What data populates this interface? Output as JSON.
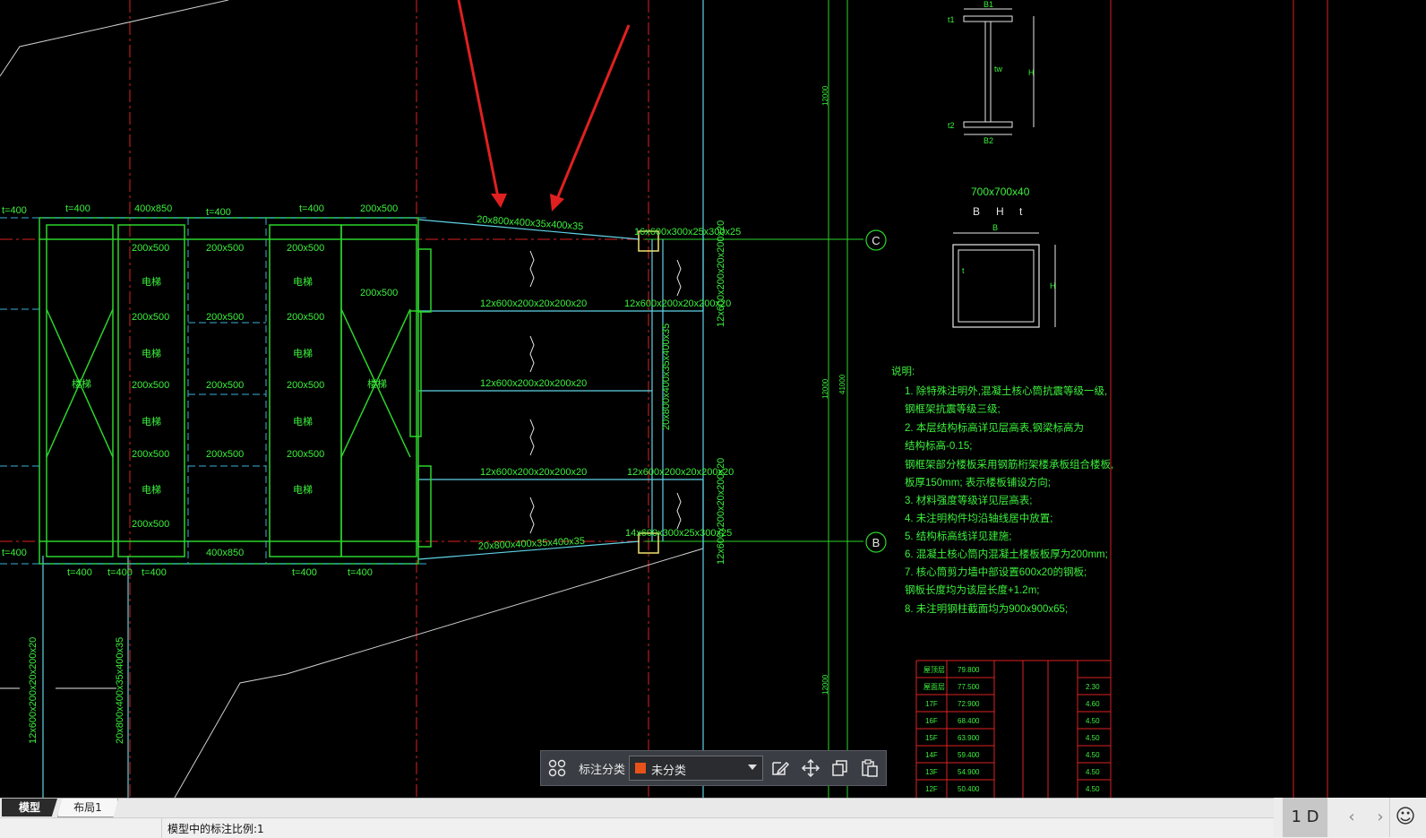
{
  "drawing": {
    "axis_labels": {
      "c": "C",
      "b": "B"
    },
    "dimensions": [
      "t=400",
      "t=400",
      "400x850",
      "t=400",
      "t=400",
      "200x500",
      "200x500",
      "200x500",
      "200x500",
      "200x500",
      "200x500",
      "200x500",
      "200x500",
      "200x500",
      "200x500",
      "200x500",
      "200x500",
      "200x500",
      "200x500",
      "200x500",
      "400x850",
      "t=400",
      "t=400",
      "t=400",
      "t=400",
      "t=400",
      "t=400"
    ],
    "beams": {
      "top_slanted": "20x800x400x35x400x35",
      "bottom_slanted": "20x800x400x35x400x35",
      "beam_1": "12x600x200x20x200x20",
      "beam_2": "12x600x200x20x200x20",
      "beam_3": "12x600x200x20x200x20",
      "beam_right_1": "12x600x200x20x200x20",
      "beam_right_2": "12x600x200x20x200x20",
      "col_top": "16x600x300x25x300x25",
      "col_bottom": "14x600x300x25x300x25",
      "vertical_1": "20x800x400x35x400x35",
      "vertical_2": "12x600x200x20x200x20",
      "vertical_3": "12x600x200x20x200x20",
      "vertical_left_1": "12x600x200x20x200x20",
      "vertical_left_2": "20x800x400x35x400x35"
    },
    "elevator_labels": [
      "电梯",
      "电梯",
      "电梯",
      "电梯",
      "电梯",
      "电梯",
      "电梯",
      "电梯"
    ],
    "stair_labels": [
      "楼梯",
      "楼梯"
    ],
    "section_i": {
      "b1": "B1",
      "b2": "B2",
      "h": "H",
      "tw": "tw",
      "t1": "t1",
      "t2": "t2"
    },
    "section_box": {
      "title": "700x700x40",
      "b": "B",
      "h": "H",
      "t": "t",
      "B_label": "B",
      "H_label": "H",
      "t_label": "t"
    },
    "notes": {
      "title": "说明:",
      "items": [
        "1. 除特殊注明外,混凝土核心筒抗震等级一级,",
        "   钢框架抗震等级三级;",
        "2. 本层结构标高详见层高表,钢梁标高为",
        "   结构标高-0.15;",
        "   钢框架部分楼板采用钢筋桁架楼承板组合楼板,",
        "   板厚150mm;      表示楼板铺设方向;",
        "3. 材料强度等级详见层高表;",
        "4. 未注明构件均沿轴线居中放置;",
        "5. 结构标高线详见建施;",
        "6. 混凝土核心筒内混凝土楼板板厚为200mm;",
        "7. 核心筒剪力墙中部设置600x20的钢板;",
        "   钢板长度均为该层长度+1.2m;",
        "8. 未注明钢柱截面均为900x900x65;"
      ]
    },
    "vertical_dims": [
      "12000",
      "12000",
      "41000",
      "12000"
    ],
    "floor_table": [
      {
        "name": "屋顶层",
        "elev": "79.800",
        "h": ""
      },
      {
        "name": "屋面层",
        "elev": "77.500",
        "h": "2.30"
      },
      {
        "name": "17F",
        "elev": "72.900",
        "h": "4.60"
      },
      {
        "name": "16F",
        "elev": "68.400",
        "h": "4.50"
      },
      {
        "name": "15F",
        "elev": "63.900",
        "h": "4.50"
      },
      {
        "name": "14F",
        "elev": "59.400",
        "h": "4.50"
      },
      {
        "name": "13F",
        "elev": "54.900",
        "h": "4.50"
      },
      {
        "name": "12F",
        "elev": "50.400",
        "h": "4.50"
      }
    ]
  },
  "annotation_toolbar": {
    "label": "标注分类",
    "select_value": "未分类",
    "swatch_color": "#e8521a"
  },
  "layout_tabs": {
    "model": "模型",
    "layout1": "布局1"
  },
  "status": {
    "text": "模型中的标注比例:1",
    "page": "1 D"
  },
  "icons": [
    "grid-icon",
    "edit-icon",
    "move-icon",
    "copy-icon",
    "paste-icon",
    "chevron-left-icon",
    "chevron-right-icon",
    "smiley-icon"
  ]
}
